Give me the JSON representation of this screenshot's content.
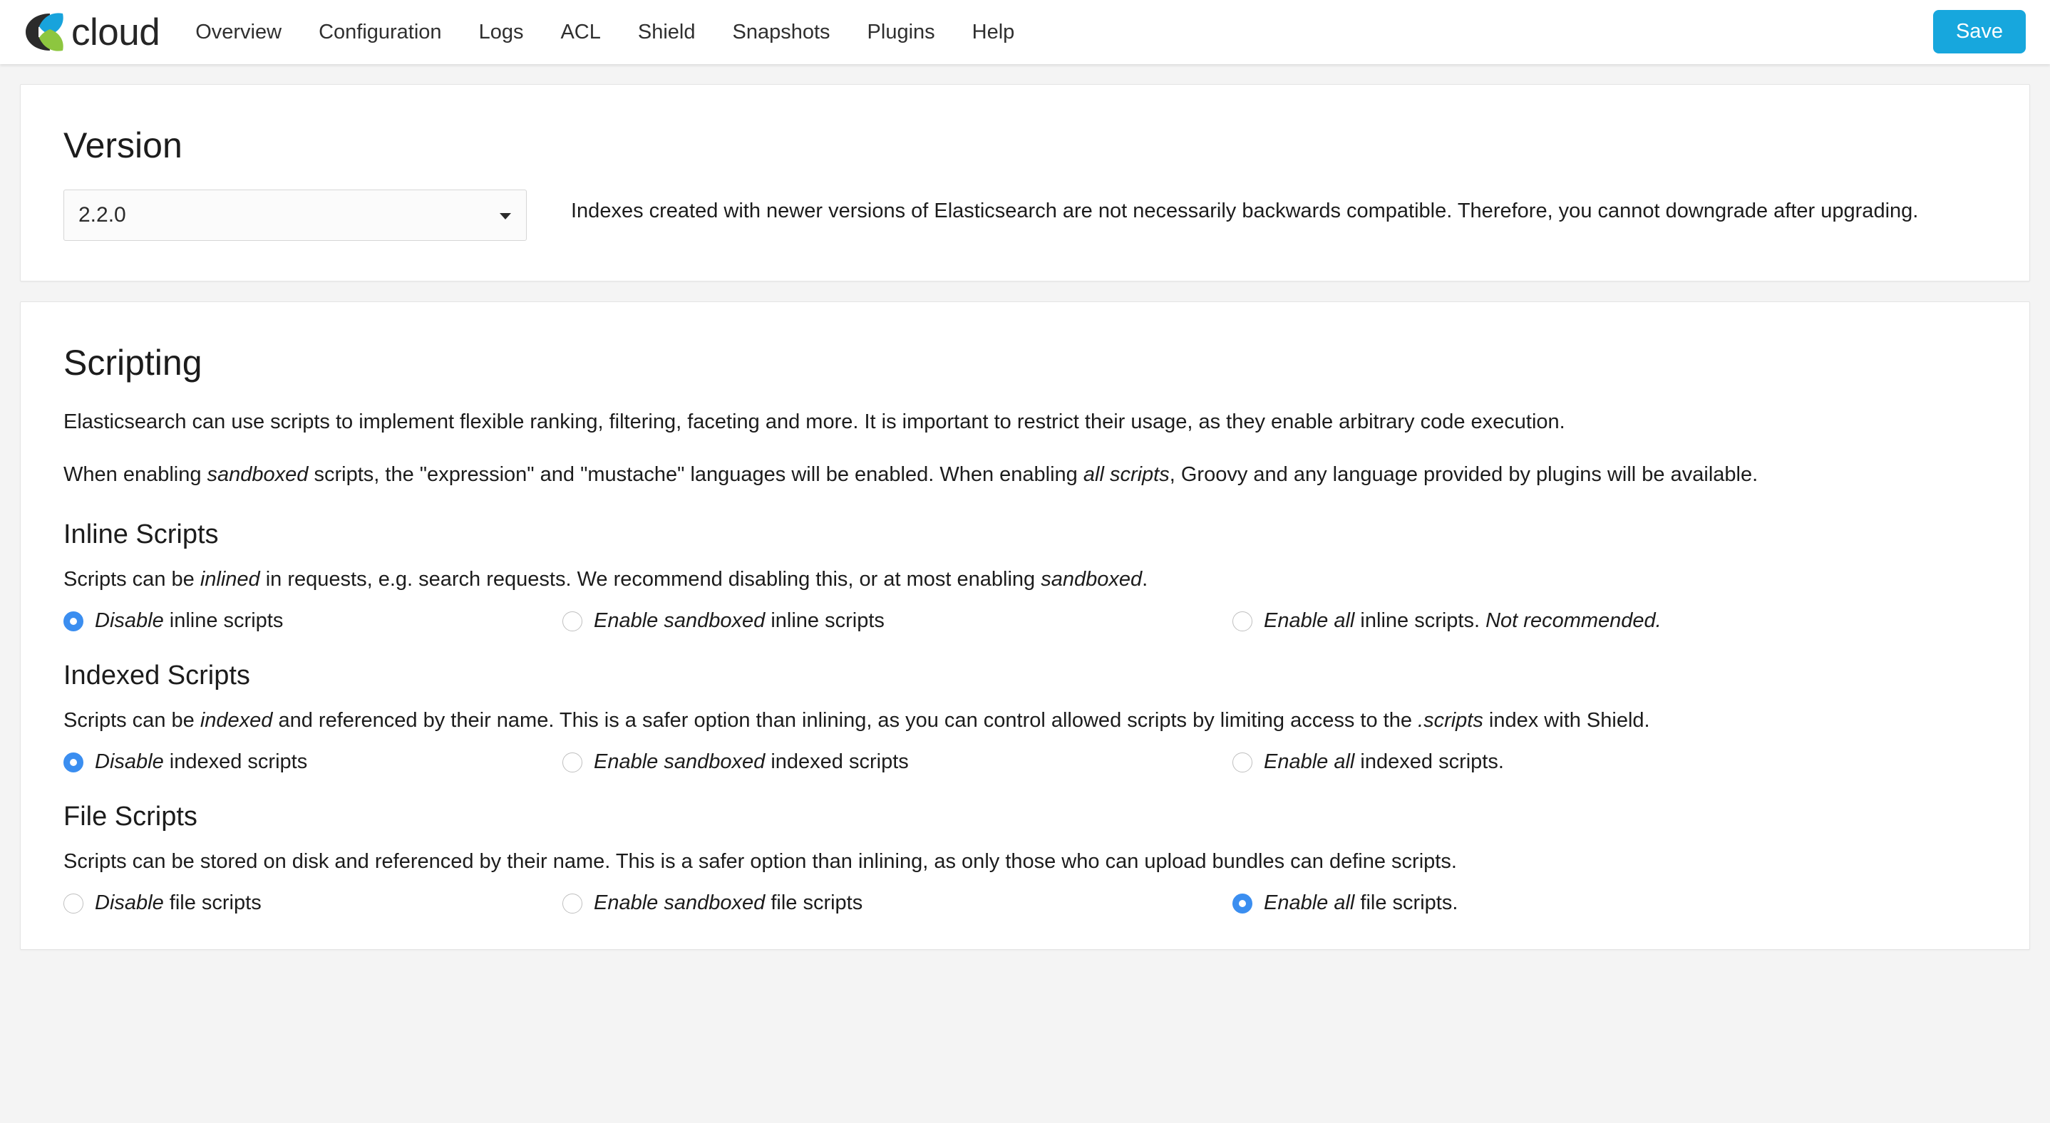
{
  "header": {
    "logo_word": "cloud",
    "logo_icon": "elastic-cloud-logo",
    "nav": [
      {
        "label": "Overview"
      },
      {
        "label": "Configuration"
      },
      {
        "label": "Logs"
      },
      {
        "label": "ACL"
      },
      {
        "label": "Shield"
      },
      {
        "label": "Snapshots"
      },
      {
        "label": "Plugins"
      },
      {
        "label": "Help"
      }
    ],
    "save_label": "Save",
    "save_color": "#17a7dd"
  },
  "version": {
    "title": "Version",
    "selected": "2.2.0",
    "options": [
      "2.2.0"
    ],
    "note": "Indexes created with newer versions of Elasticsearch are not necessarily backwards compatible. Therefore, you cannot downgrade after upgrading."
  },
  "scripting": {
    "title": "Scripting",
    "intro": "Elasticsearch can use scripts to implement flexible ranking, filtering, faceting and more. It is important to restrict their usage, as they enable arbitrary code execution.",
    "intro2": {
      "p1": "When enabling ",
      "em1": "sandboxed",
      "p2": " scripts, the \"expression\" and \"mustache\" languages will be enabled. When enabling ",
      "em2": "all scripts",
      "p3": ", Groovy and any language provided by plugins will be available."
    },
    "inline": {
      "title": "Inline Scripts",
      "desc": {
        "p1": "Scripts can be ",
        "em1": "inlined",
        "p2": " in requests, e.g. search requests. We recommend disabling this, or at most enabling ",
        "em2": "sandboxed",
        "p3": "."
      },
      "options": [
        {
          "em": "Disable",
          "rest": " inline scripts",
          "em_tail": "",
          "checked": true
        },
        {
          "em": "Enable sandboxed",
          "rest": " inline scripts",
          "em_tail": "",
          "checked": false
        },
        {
          "em": "Enable all",
          "rest": " inline scripts. ",
          "em_tail": "Not recommended.",
          "checked": false
        }
      ]
    },
    "indexed": {
      "title": "Indexed Scripts",
      "desc": {
        "p1": "Scripts can be ",
        "em1": "indexed",
        "p2": " and referenced by their name. This is a safer option than inlining, as you can control allowed scripts by limiting access to the ",
        "em2": ".scripts",
        "p3": " index with Shield."
      },
      "options": [
        {
          "em": "Disable",
          "rest": " indexed scripts",
          "em_tail": "",
          "checked": true
        },
        {
          "em": "Enable sandboxed",
          "rest": " indexed scripts",
          "em_tail": "",
          "checked": false
        },
        {
          "em": "Enable all",
          "rest": " indexed scripts.",
          "em_tail": "",
          "checked": false
        }
      ]
    },
    "file": {
      "title": "File Scripts",
      "desc": {
        "p1": "Scripts can be stored on disk and referenced by their name. This is a safer option than inlining, as only those who can upload bundles can define scripts.",
        "em1": "",
        "p2": "",
        "em2": "",
        "p3": ""
      },
      "options": [
        {
          "em": "Disable",
          "rest": " file scripts",
          "em_tail": "",
          "checked": false
        },
        {
          "em": "Enable sandboxed",
          "rest": " file scripts",
          "em_tail": "",
          "checked": false
        },
        {
          "em": "Enable all",
          "rest": " file scripts.",
          "em_tail": "",
          "checked": true
        }
      ]
    }
  }
}
